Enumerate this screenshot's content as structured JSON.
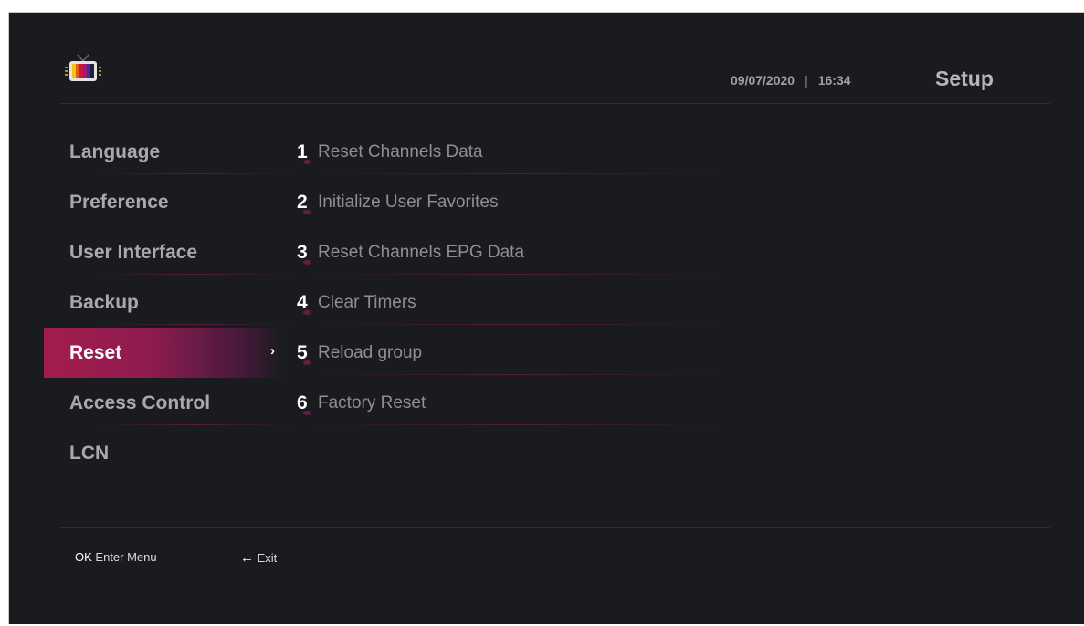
{
  "header": {
    "date": "09/07/2020",
    "separator": "|",
    "time": "16:34",
    "title": "Setup",
    "logo_icon": "tv-icon"
  },
  "sidebar": {
    "items": [
      {
        "label": "Language"
      },
      {
        "label": "Preference"
      },
      {
        "label": "User Interface"
      },
      {
        "label": "Backup"
      },
      {
        "label": "Reset",
        "active": true
      },
      {
        "label": "Access Control"
      },
      {
        "label": "LCN"
      }
    ],
    "active_indicator": "›"
  },
  "options": {
    "items": [
      {
        "num": "1",
        "label": "Reset Channels Data"
      },
      {
        "num": "2",
        "label": "Initialize User Favorites"
      },
      {
        "num": "3",
        "label": "Reset Channels EPG Data"
      },
      {
        "num": "4",
        "label": "Clear Timers"
      },
      {
        "num": "5",
        "label": "Reload group"
      },
      {
        "num": "6",
        "label": "Factory Reset"
      }
    ]
  },
  "footer": {
    "ok_key": "OK",
    "ok_label": "Enter Menu",
    "exit_arrow": "←",
    "exit_label": "Exit"
  },
  "colors": {
    "background": "#1a1b1f",
    "accent": "#a21d4d",
    "text_muted": "#a8a9ae"
  }
}
